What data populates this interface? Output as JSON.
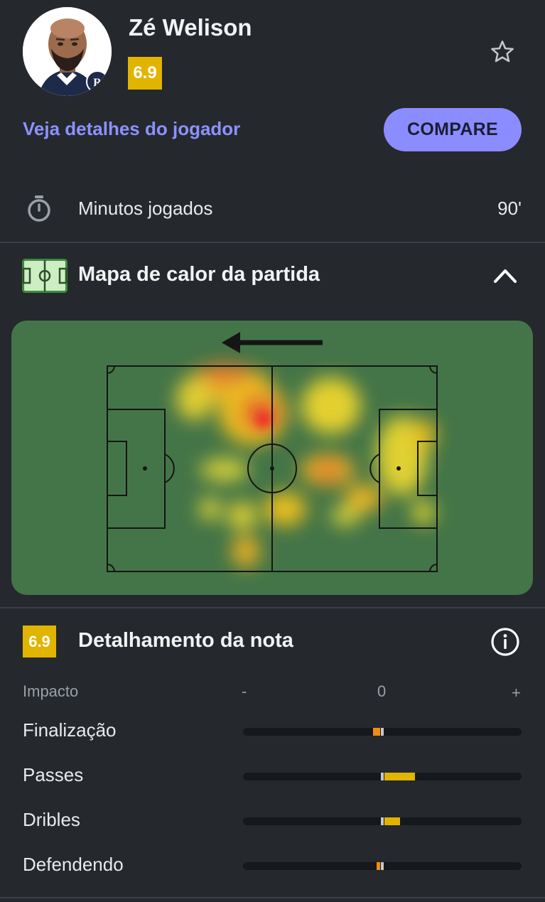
{
  "player": {
    "name": "Zé Welison",
    "rating": "6.9",
    "details_link": "Veja detalhes do jogador",
    "compare_label": "COMPARE"
  },
  "stats": {
    "minutes_label": "Minutos jogados",
    "minutes_value": "90'"
  },
  "heatmap": {
    "title": "Mapa de calor da partida",
    "attack_direction": "left"
  },
  "breakdown": {
    "rating": "6.9",
    "title": "Detalhamento da nota",
    "impact_label": "Impacto",
    "scale": {
      "min": "-",
      "mid": "0",
      "max": "+"
    },
    "metrics": [
      {
        "label": "Finalização",
        "impact": -0.05,
        "color": "#f28c0f"
      },
      {
        "label": "Passes",
        "impact": 0.22,
        "color": "#e1b400"
      },
      {
        "label": "Dribles",
        "impact": 0.11,
        "color": "#e1b400"
      },
      {
        "label": "Defendendo",
        "impact": -0.025,
        "color": "#f28c0f"
      }
    ]
  },
  "colors": {
    "accent": "#8b8cff",
    "rating_badge": "#e1b400",
    "background": "#25282d",
    "pitch": "#447548"
  }
}
